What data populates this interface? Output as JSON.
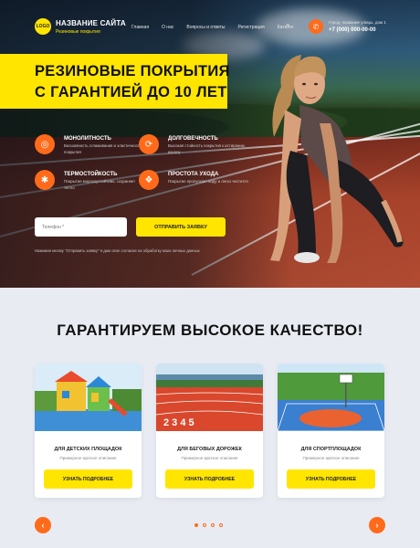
{
  "header": {
    "logo_text": "LOGO",
    "site_name": "НАЗВАНИЕ САЙТА",
    "site_subtitle": "Резиновые покрытия",
    "nav": [
      "Главная",
      "О нас",
      "Вопросы и ответы",
      "Регистрация",
      "Каталог"
    ],
    "address": "Город, название улицы, дом 1",
    "phone": "+7 (000) 000-00-00"
  },
  "hero": {
    "headline_line1": "РЕЗИНОВЫЕ ПОКРЫТИЯ",
    "headline_line2": "С ГАРАНТИЕЙ ДО 10 ЛЕТ",
    "features": [
      {
        "icon": "layers-icon",
        "title": "МОНОЛИТНОСТЬ",
        "text": "Бесшовность сглаживания и эластичность покрытия"
      },
      {
        "icon": "clock-icon",
        "title": "ДОЛГОВЕЧНОСТЬ",
        "text": "Высокая стойкость покрытия к истиранию износу"
      },
      {
        "icon": "thermometer-icon",
        "title": "ТЕРМОСТОЙКОСТЬ",
        "text": "Покрытие морозоустойчиво, сохраняет тепло"
      },
      {
        "icon": "drop-icon",
        "title": "ПРОСТОТА УХОДА",
        "text": "Покрытие пропускает воду и легко чистится"
      }
    ],
    "phone_placeholder": "Телефон *",
    "submit_label": "ОТПРАВИТЬ ЗАЯВКУ",
    "consent": "Нажимая кнопку \"Отправить заявку\" я даю свое согласие на обработку моих личных данных"
  },
  "quality": {
    "title": "ГАРАНТИРУЕМ ВЫСОКОЕ КАЧЕСТВО!",
    "cards": [
      {
        "title": "ДЛЯ ДЕТСКИХ ПЛОЩАДОК",
        "desc": "Примерное краткое описание",
        "button": "УЗНАТЬ ПОДРОБНЕЕ"
      },
      {
        "title": "ДЛЯ БЕГОВЫХ ДОРОЖЕК",
        "desc": "Примерное краткое описание",
        "button": "УЗНАТЬ ПОДРОБНЕЕ"
      },
      {
        "title": "ДЛЯ СПОРТПЛОЩАДОК",
        "desc": "Примерное краткое описание",
        "button": "УЗНАТЬ ПОДРОБНЕЕ"
      }
    ],
    "prev_icon": "chevron-left-icon",
    "next_icon": "chevron-right-icon",
    "active_dot": 0,
    "dot_count": 4
  },
  "colors": {
    "accent_yellow": "#ffe500",
    "accent_orange": "#ff6b1a",
    "section_bg": "#e8ebf2"
  }
}
